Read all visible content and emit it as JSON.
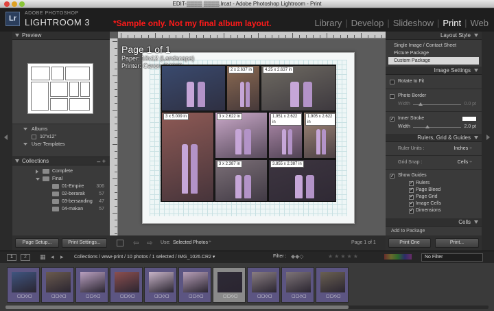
{
  "window": {
    "title": "EDIT-▒▒▒▒ ▒▒▒▒.lrcat - Adobe Photoshop Lightroom - Print"
  },
  "identity": {
    "logo": "Lr",
    "line1": "ADOBE PHOTOSHOP",
    "line2": "LIGHTROOM 3",
    "note": "*Sample only. Not my final album layout."
  },
  "modules": [
    "Library",
    "Develop",
    "Slideshow",
    "Print",
    "Web"
  ],
  "active_module": "Print",
  "left_panel": {
    "preview_title": "Preview",
    "templates": [
      {
        "label": "Albums",
        "type": "folder"
      },
      {
        "label": "10\"x12\"",
        "type": "item"
      },
      {
        "label": "User Templates",
        "type": "folder"
      }
    ],
    "collections_title": "Collections",
    "collections_controls": "– +",
    "collections": [
      {
        "label": "Complete",
        "count": "",
        "child": false
      },
      {
        "label": "Final",
        "count": "",
        "child": false
      },
      {
        "label": "01-Empire",
        "count": "306",
        "child": true
      },
      {
        "label": "02-berarak",
        "count": "57",
        "child": true
      },
      {
        "label": "03-bersanding",
        "count": "47",
        "child": true
      },
      {
        "label": "04-makan",
        "count": "57",
        "child": true
      }
    ],
    "page_setup_label": "Page Setup...",
    "print_settings_label": "Print Settings..."
  },
  "right_panel": {
    "layout_style_title": "Layout Style",
    "layout_styles": [
      "Single Image / Contact Sheet",
      "Picture Package",
      "Custom Package"
    ],
    "selected_layout": "Custom Package",
    "image_settings_title": "Image Settings",
    "rotate_to_fit": "Rotate to Fit",
    "photo_border": "Photo Border",
    "border_width_label": "Width",
    "border_width_value": "0.0 pt",
    "inner_stroke": "Inner Stroke",
    "stroke_width_label": "Width",
    "stroke_width_value": "2.0 pt",
    "rulers_title": "Rulers, Grid & Guides",
    "ruler_units_label": "Ruler Units :",
    "ruler_units_value": "Inches",
    "grid_snap_label": "Grid Snap :",
    "grid_snap_value": "Cells",
    "show_guides": "Show Guides",
    "guides": [
      "Rulers",
      "Page Bleed",
      "Page Grid",
      "Image Cells",
      "Dimensions"
    ],
    "cells_title": "Cells",
    "add_to_package": "Add to Package",
    "print_one_label": "Print One",
    "print_label": "Print..."
  },
  "canvas": {
    "page_label": "Page 1 of 1",
    "paper": "Paper: 10x12 (Landscape)",
    "printer": "Printer: Canon iP4000",
    "cells": [
      {
        "label": "",
        "bg": "#3a4a6e"
      },
      {
        "label": "2 x 2.637 in",
        "bg": "#8b6a52"
      },
      {
        "label": "4.25 x 2.637 in",
        "bg": "#6e6a62"
      },
      {
        "label": "3 x 5.009 in",
        "bg": "#8e5a55"
      },
      {
        "label": "3 x 2.622 in",
        "bg": "#c9a8c8"
      },
      {
        "label": "1.951 x 2.622 in",
        "bg": "#b48fb0"
      },
      {
        "label": "1.905 x 2.622 in",
        "bg": "#a48a7a"
      },
      {
        "label": "3 x 2.387 in",
        "bg": "#7b6f77"
      },
      {
        "label": "3.855 x 2.387 in",
        "bg": "#3d3540"
      }
    ]
  },
  "center_toolbar": {
    "use_label": "Use:",
    "use_value": "Selected Photos",
    "page_count": "Page 1 of 1"
  },
  "filmstrip_bar": {
    "screen1": "1",
    "screen2": "2",
    "path": "Collections / www-print / 10 photos / 1 selected / IMG_1026.CR2 ▾",
    "filter_label": "Filter :",
    "filter_value": "No Filter"
  },
  "thumbnails": [
    {
      "bg": "#3f5580"
    },
    {
      "bg": "#6a5a4e"
    },
    {
      "bg": "#b9a0c0"
    },
    {
      "bg": "#8c4f4f"
    },
    {
      "bg": "#c8b4c8"
    },
    {
      "bg": "#b79fb8"
    },
    {
      "bg": "#2e2a36"
    },
    {
      "bg": "#8a7e82"
    },
    {
      "bg": "#7e7478"
    },
    {
      "bg": "#6a6052"
    }
  ],
  "selected_thumb": 6,
  "thumb_badge": "▢▢◇▢",
  "colors": {
    "accent_red": "#ff1a1a",
    "film_bg": "#5c5582"
  }
}
